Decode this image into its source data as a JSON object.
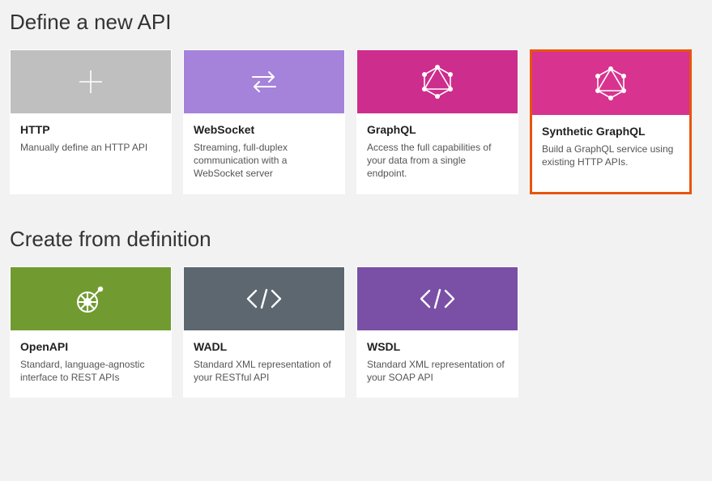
{
  "section1": {
    "title": "Define a new API",
    "cards": [
      {
        "title": "HTTP",
        "desc": "Manually define an HTTP API"
      },
      {
        "title": "WebSocket",
        "desc": "Streaming, full-duplex communication with a WebSocket server"
      },
      {
        "title": "GraphQL",
        "desc": "Access the full capabilities of your data from a single endpoint."
      },
      {
        "title": "Synthetic GraphQL",
        "desc": "Build a GraphQL service using existing HTTP APIs."
      }
    ]
  },
  "section2": {
    "title": "Create from definition",
    "cards": [
      {
        "title": "OpenAPI",
        "desc": "Standard, language-agnostic interface to REST APIs"
      },
      {
        "title": "WADL",
        "desc": "Standard XML representation of your RESTful API"
      },
      {
        "title": "WSDL",
        "desc": "Standard XML representation of your SOAP API"
      }
    ]
  }
}
